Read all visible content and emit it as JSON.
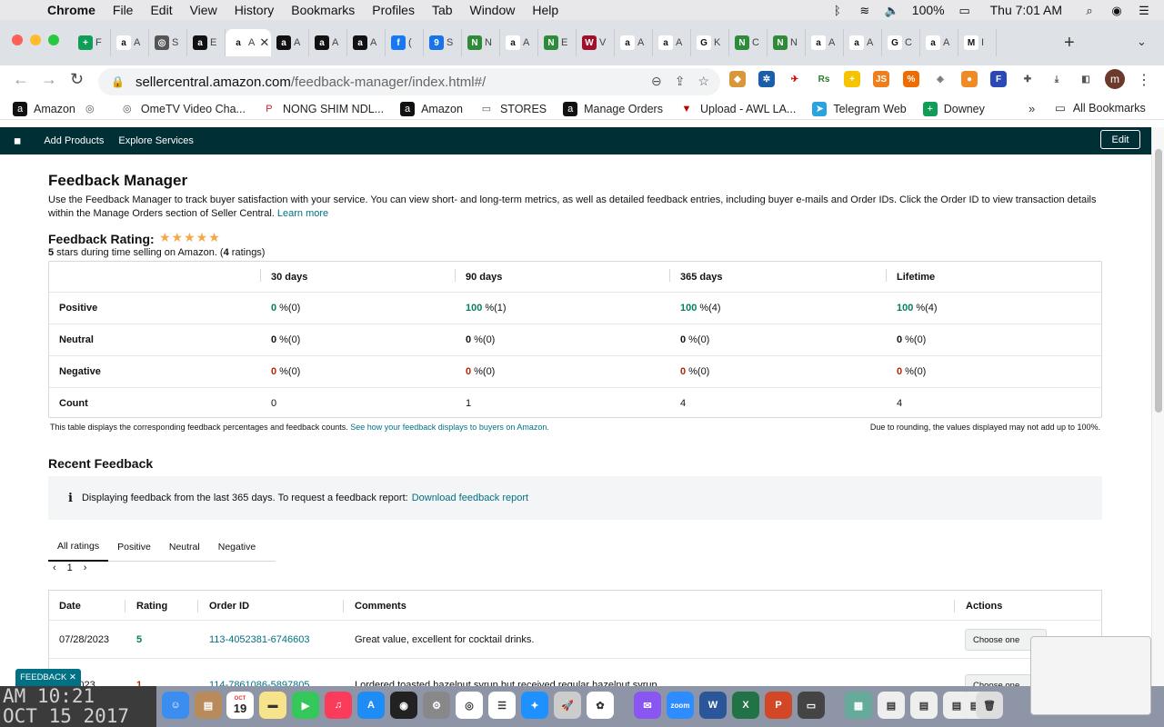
{
  "menubar": {
    "app": "Chrome",
    "items": [
      "File",
      "Edit",
      "View",
      "History",
      "Bookmarks",
      "Profiles",
      "Tab",
      "Window",
      "Help"
    ],
    "battery": "100%",
    "clock": "Thu 7:01 AM"
  },
  "tabs": [
    {
      "label": "F",
      "icon": "google-sheets-icon",
      "color": "#0f9d58",
      "glyph": "+"
    },
    {
      "label": "A",
      "icon": "amazon-icon",
      "color": "#fff",
      "glyph": "a"
    },
    {
      "label": "S",
      "icon": "globe-icon",
      "color": "#555",
      "glyph": "◎"
    },
    {
      "label": "E",
      "icon": "amazon-icon",
      "color": "#111",
      "glyph": "a"
    },
    {
      "label": "A",
      "icon": "amazon-icon",
      "color": "#fff",
      "glyph": "a"
    },
    {
      "label": "A",
      "icon": "amazon-icon",
      "color": "#111",
      "glyph": "a"
    },
    {
      "label": "A",
      "icon": "amazon-icon",
      "color": "#111",
      "glyph": "a"
    },
    {
      "label": "A",
      "icon": "amazon-icon",
      "color": "#111",
      "glyph": "a"
    },
    {
      "label": "(",
      "icon": "facebook-icon",
      "color": "#1877f2",
      "glyph": "f"
    },
    {
      "label": "S",
      "icon": "badge-icon",
      "color": "#1a73e8",
      "glyph": "9"
    },
    {
      "label": "N",
      "icon": "n-icon",
      "color": "#2e8b3a",
      "glyph": "N"
    },
    {
      "label": "A",
      "icon": "amazon-icon",
      "color": "#fff",
      "glyph": "a"
    },
    {
      "label": "E",
      "icon": "n-icon",
      "color": "#2e8b3a",
      "glyph": "N"
    },
    {
      "label": "V",
      "icon": "vw-icon",
      "color": "#a0102a",
      "glyph": "W"
    },
    {
      "label": "A",
      "icon": "amazon-icon",
      "color": "#fff",
      "glyph": "a"
    },
    {
      "label": "A",
      "icon": "amazon-icon",
      "color": "#fff",
      "glyph": "a"
    },
    {
      "label": "K",
      "icon": "google-icon",
      "color": "#fff",
      "glyph": "G"
    },
    {
      "label": "C",
      "icon": "n-icon",
      "color": "#2e8b3a",
      "glyph": "N"
    },
    {
      "label": "N",
      "icon": "n-icon",
      "color": "#2e8b3a",
      "glyph": "N"
    },
    {
      "label": "A",
      "icon": "amazon-icon",
      "color": "#fff",
      "glyph": "a"
    },
    {
      "label": "A",
      "icon": "amazon-icon",
      "color": "#fff",
      "glyph": "a"
    },
    {
      "label": "C",
      "icon": "google-icon",
      "color": "#fff",
      "glyph": "G"
    },
    {
      "label": "A",
      "icon": "amazon-icon",
      "color": "#fff",
      "glyph": "a"
    },
    {
      "label": "I",
      "icon": "gmail-icon",
      "color": "#fff",
      "glyph": "M"
    }
  ],
  "active_tab_label": "A",
  "url": {
    "host": "sellercentral.amazon.com",
    "path": "/feedback-manager/index.html#/"
  },
  "bookmarks": [
    {
      "label": "Amazon",
      "icon": "amazon-icon"
    },
    {
      "label": "",
      "icon": "globe-icon"
    },
    {
      "label": "OmeTV Video Cha...",
      "icon": "globe-icon"
    },
    {
      "label": "NONG SHIM NDL...",
      "icon": "pinterest-icon"
    },
    {
      "label": "Amazon",
      "icon": "amazon-icon"
    },
    {
      "label": "STORES",
      "icon": "folder-icon"
    },
    {
      "label": "Manage Orders",
      "icon": "amazon-icon"
    },
    {
      "label": "Upload - AWL LA...",
      "icon": "awl-icon"
    },
    {
      "label": "Telegram Web",
      "icon": "telegram-icon"
    },
    {
      "label": "Downey",
      "icon": "google-sheets-icon"
    }
  ],
  "all_bookmarks": "All Bookmarks",
  "amz_nav": {
    "links": [
      "Add Products",
      "Explore Services"
    ],
    "edit": "Edit"
  },
  "page": {
    "title": "Feedback Manager",
    "description": "Use the Feedback Manager to track buyer satisfaction with your service. You can view short- and long-term metrics, as well as detailed feedback entries, including buyer e-mails and Order IDs. Click the Order ID to view transaction details within the Manage Orders section of Seller Central.",
    "learn_more": "Learn more",
    "rating_label": "Feedback Rating:",
    "stars": "★★★★★",
    "rating_stars_value": 5,
    "rating_sub_a": "5",
    "rating_sub_b": " stars during time selling on Amazon. (",
    "rating_sub_c": "4",
    "rating_sub_d": " ratings)"
  },
  "metrics": {
    "columns": [
      "30 days",
      "90 days",
      "365 days",
      "Lifetime"
    ],
    "rows": [
      {
        "label": "Positive",
        "cells": [
          {
            "v": "0",
            "s": "%(0)"
          },
          {
            "v": "100",
            "s": "%(1)"
          },
          {
            "v": "100",
            "s": "%(4)"
          },
          {
            "v": "100",
            "s": "%(4)"
          }
        ]
      },
      {
        "label": "Neutral",
        "cells": [
          {
            "v": "0",
            "s": "%(0)"
          },
          {
            "v": "0",
            "s": "%(0)"
          },
          {
            "v": "0",
            "s": "%(0)"
          },
          {
            "v": "0",
            "s": "%(0)"
          }
        ]
      },
      {
        "label": "Negative",
        "cells": [
          {
            "v": "0",
            "s": "%(0)"
          },
          {
            "v": "0",
            "s": "%(0)"
          },
          {
            "v": "0",
            "s": "%(0)"
          },
          {
            "v": "0",
            "s": "%(0)"
          }
        ]
      },
      {
        "label": "Count",
        "cells": [
          {
            "v": "",
            "s": "0"
          },
          {
            "v": "",
            "s": "1"
          },
          {
            "v": "",
            "s": "4"
          },
          {
            "v": "",
            "s": "4"
          }
        ]
      }
    ],
    "note_left": "This table displays the corresponding feedback percentages and feedback counts.",
    "note_link": "See how your feedback displays to buyers on Amazon.",
    "note_right": "Due to rounding, the values displayed may not add up to 100%."
  },
  "recent": {
    "title": "Recent Feedback",
    "info_icon": "i",
    "info_text": "Displaying feedback from the last 365 days. To request a feedback report:",
    "info_link": "Download feedback report",
    "tabs": [
      "All ratings",
      "Positive",
      "Neutral",
      "Negative"
    ],
    "page": "1",
    "columns": [
      "Date",
      "Rating",
      "Order ID",
      "Comments",
      "Actions"
    ],
    "rows": [
      {
        "date": "07/28/2023",
        "rating": "5",
        "order": "113-4052381-6746603",
        "comment": "Great value, excellent for cocktail drinks.",
        "action": "Choose one"
      },
      {
        "date": "07/2023",
        "rating": "1",
        "order": "114-7861086-5897805",
        "comment": "I ordered toasted hazelnut syrup but received regular hazelnut syrup",
        "action": "Choose one"
      }
    ]
  },
  "feedback_tag": "FEEDBACK ✕",
  "desktop_clock": "AM 10:21\nOCT 15 2017",
  "calendar": {
    "month": "OCT",
    "day": "19"
  }
}
